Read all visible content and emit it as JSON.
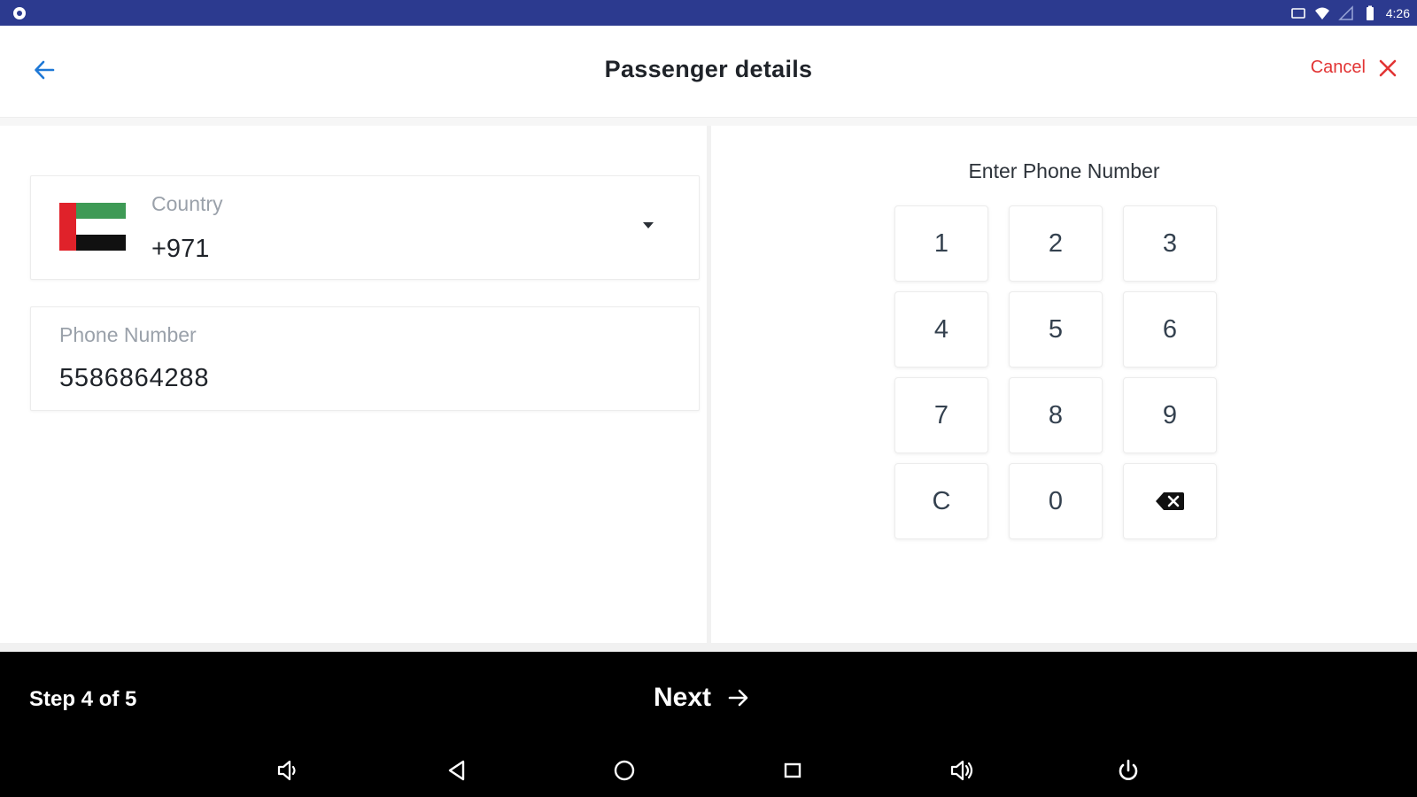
{
  "status_bar": {
    "left_icon": "settings-gear-icon",
    "right_icons": [
      "sim-icon",
      "wifi-icon",
      "no-signal-icon",
      "battery-icon"
    ],
    "time": "4:26"
  },
  "header": {
    "back_icon": "arrow-left-icon",
    "title": "Passenger details",
    "cancel_label": "Cancel",
    "cancel_icon": "close-icon",
    "accent_color": "#e23434",
    "back_color": "#1e78d6"
  },
  "form": {
    "country": {
      "label": "Country",
      "value": "+971",
      "flag": "uae-flag",
      "dropdown_icon": "caret-down-icon"
    },
    "phone": {
      "label": "Phone Number",
      "value": "5586864288"
    }
  },
  "keypad": {
    "title": "Enter Phone Number",
    "keys": [
      "1",
      "2",
      "3",
      "4",
      "5",
      "6",
      "7",
      "8",
      "9",
      "C",
      "0",
      ""
    ],
    "backspace_icon": "backspace-icon"
  },
  "footer": {
    "step": "Step 4 of 5",
    "next_label": "Next",
    "next_icon": "arrow-right-icon"
  },
  "nav_bar": {
    "buttons": [
      "volume-down-icon",
      "back-triangle-icon",
      "home-circle-icon",
      "recents-square-icon",
      "volume-up-icon",
      "power-icon"
    ]
  }
}
